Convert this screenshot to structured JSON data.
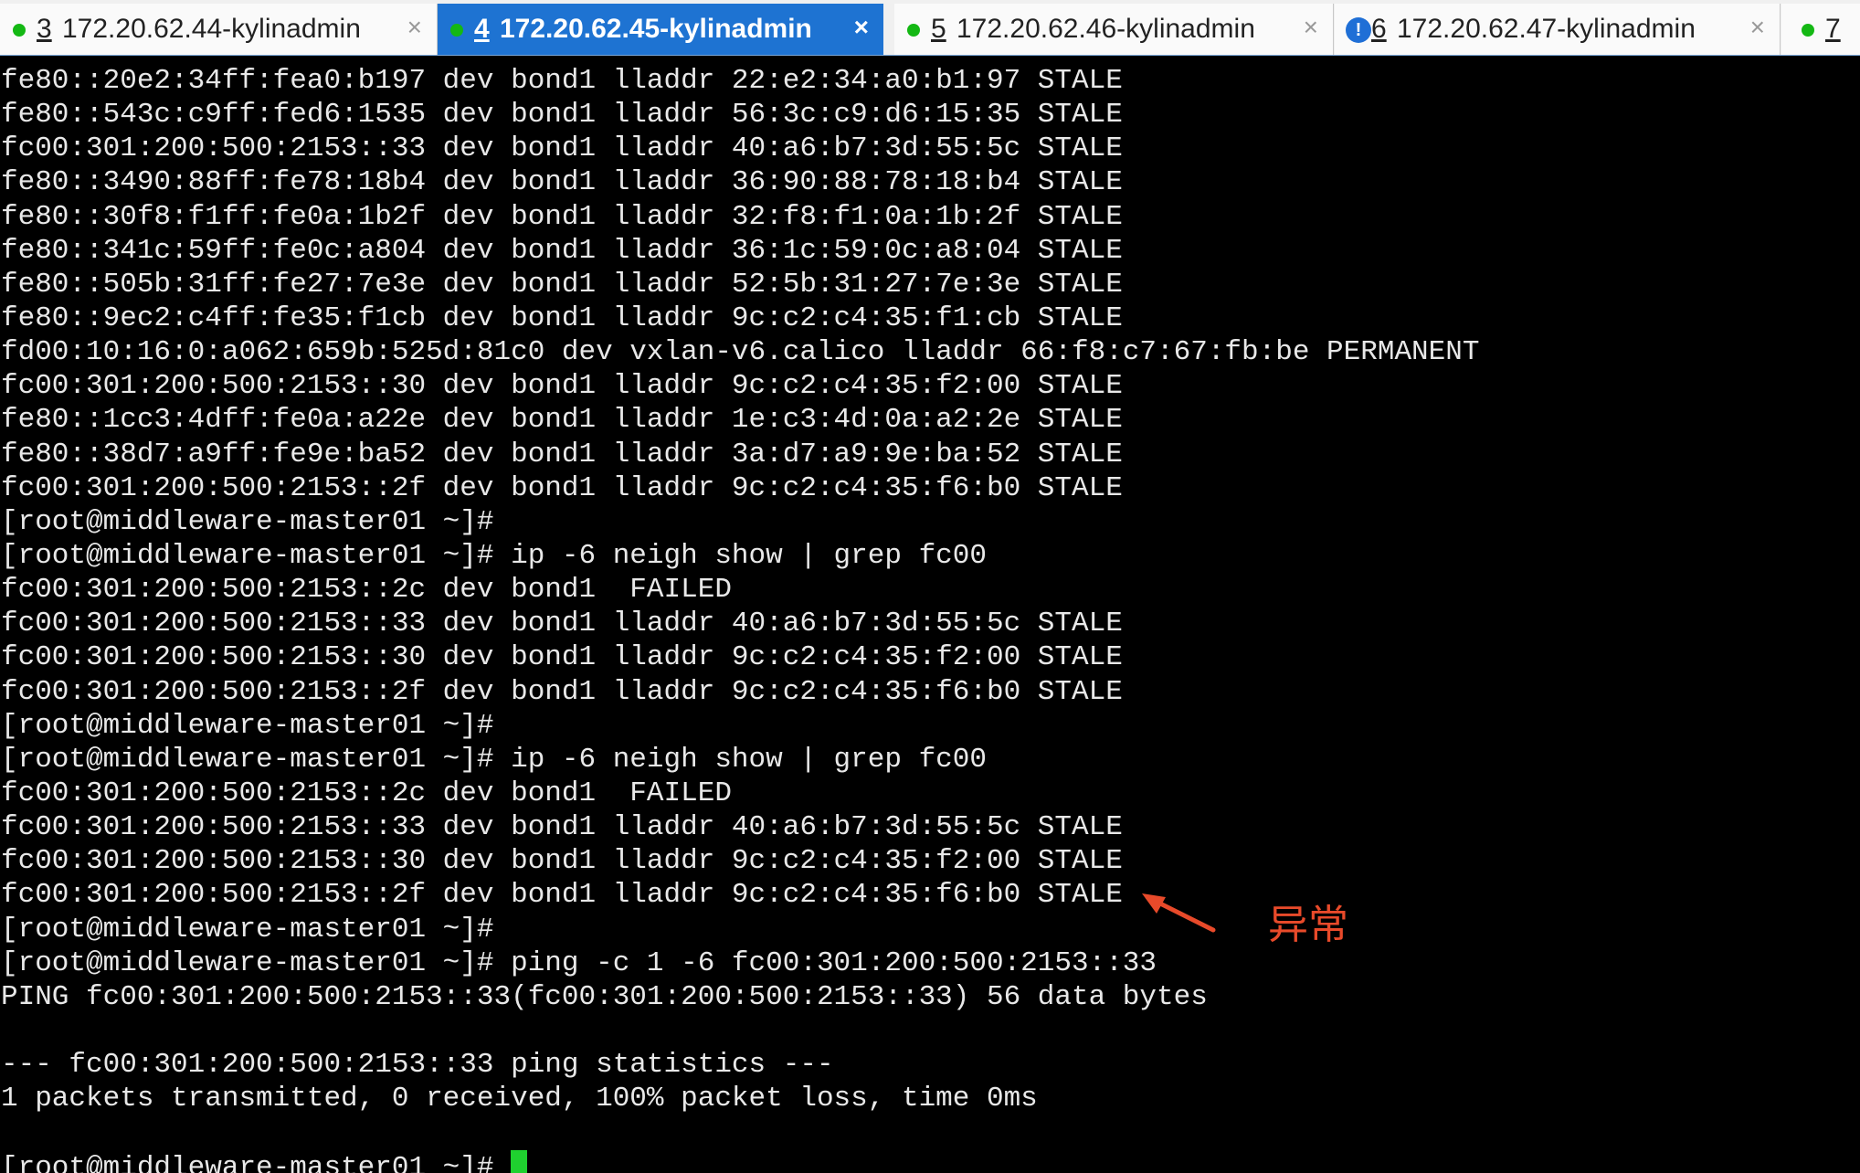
{
  "tabs": [
    {
      "number": "3",
      "title": "172.20.62.44-kylinadmin",
      "status": "connected",
      "active": false
    },
    {
      "number": "4",
      "title": "172.20.62.45-kylinadmin",
      "status": "connected",
      "active": true
    },
    {
      "number": "5",
      "title": "172.20.62.46-kylinadmin",
      "status": "connected",
      "active": false
    },
    {
      "number": "6",
      "title": "172.20.62.47-kylinadmin",
      "status": "alert",
      "active": false
    },
    {
      "number": "7",
      "title": "",
      "status": "connected",
      "active": false
    }
  ],
  "colors": {
    "connected_dot": "#14b814",
    "alert_icon": "#1f6fd6",
    "active_tab": "#1e73d2",
    "cursor": "#1fd12f",
    "annotation": "#e84a2a"
  },
  "icons": {
    "connected": "green-dot-icon",
    "alert": "exclamation-icon",
    "close": "close-icon"
  },
  "terminal": {
    "lines": [
      "fe80::20e2:34ff:fea0:b197 dev bond1 lladdr 22:e2:34:a0:b1:97 STALE",
      "fe80::543c:c9ff:fed6:1535 dev bond1 lladdr 56:3c:c9:d6:15:35 STALE",
      "fc00:301:200:500:2153::33 dev bond1 lladdr 40:a6:b7:3d:55:5c STALE",
      "fe80::3490:88ff:fe78:18b4 dev bond1 lladdr 36:90:88:78:18:b4 STALE",
      "fe80::30f8:f1ff:fe0a:1b2f dev bond1 lladdr 32:f8:f1:0a:1b:2f STALE",
      "fe80::341c:59ff:fe0c:a804 dev bond1 lladdr 36:1c:59:0c:a8:04 STALE",
      "fe80::505b:31ff:fe27:7e3e dev bond1 lladdr 52:5b:31:27:7e:3e STALE",
      "fe80::9ec2:c4ff:fe35:f1cb dev bond1 lladdr 9c:c2:c4:35:f1:cb STALE",
      "fd00:10:16:0:a062:659b:525d:81c0 dev vxlan-v6.calico lladdr 66:f8:c7:67:fb:be PERMANENT",
      "fc00:301:200:500:2153::30 dev bond1 lladdr 9c:c2:c4:35:f2:00 STALE",
      "fe80::1cc3:4dff:fe0a:a22e dev bond1 lladdr 1e:c3:4d:0a:a2:2e STALE",
      "fe80::38d7:a9ff:fe9e:ba52 dev bond1 lladdr 3a:d7:a9:9e:ba:52 STALE",
      "fc00:301:200:500:2153::2f dev bond1 lladdr 9c:c2:c4:35:f6:b0 STALE",
      "[root@middleware-master01 ~]#",
      "[root@middleware-master01 ~]# ip -6 neigh show | grep fc00",
      "fc00:301:200:500:2153::2c dev bond1  FAILED",
      "fc00:301:200:500:2153::33 dev bond1 lladdr 40:a6:b7:3d:55:5c STALE",
      "fc00:301:200:500:2153::30 dev bond1 lladdr 9c:c2:c4:35:f2:00 STALE",
      "fc00:301:200:500:2153::2f dev bond1 lladdr 9c:c2:c4:35:f6:b0 STALE",
      "[root@middleware-master01 ~]#",
      "[root@middleware-master01 ~]# ip -6 neigh show | grep fc00",
      "fc00:301:200:500:2153::2c dev bond1  FAILED",
      "fc00:301:200:500:2153::33 dev bond1 lladdr 40:a6:b7:3d:55:5c STALE",
      "fc00:301:200:500:2153::30 dev bond1 lladdr 9c:c2:c4:35:f2:00 STALE",
      "fc00:301:200:500:2153::2f dev bond1 lladdr 9c:c2:c4:35:f6:b0 STALE",
      "[root@middleware-master01 ~]#",
      "[root@middleware-master01 ~]# ping -c 1 -6 fc00:301:200:500:2153::33",
      "PING fc00:301:200:500:2153::33(fc00:301:200:500:2153::33) 56 data bytes",
      "",
      "--- fc00:301:200:500:2153::33 ping statistics ---",
      "1 packets transmitted, 0 received, 100% packet loss, time 0ms",
      ""
    ],
    "prompt": "[root@middleware-master01 ~]# "
  },
  "annotation": {
    "label": "异常"
  }
}
